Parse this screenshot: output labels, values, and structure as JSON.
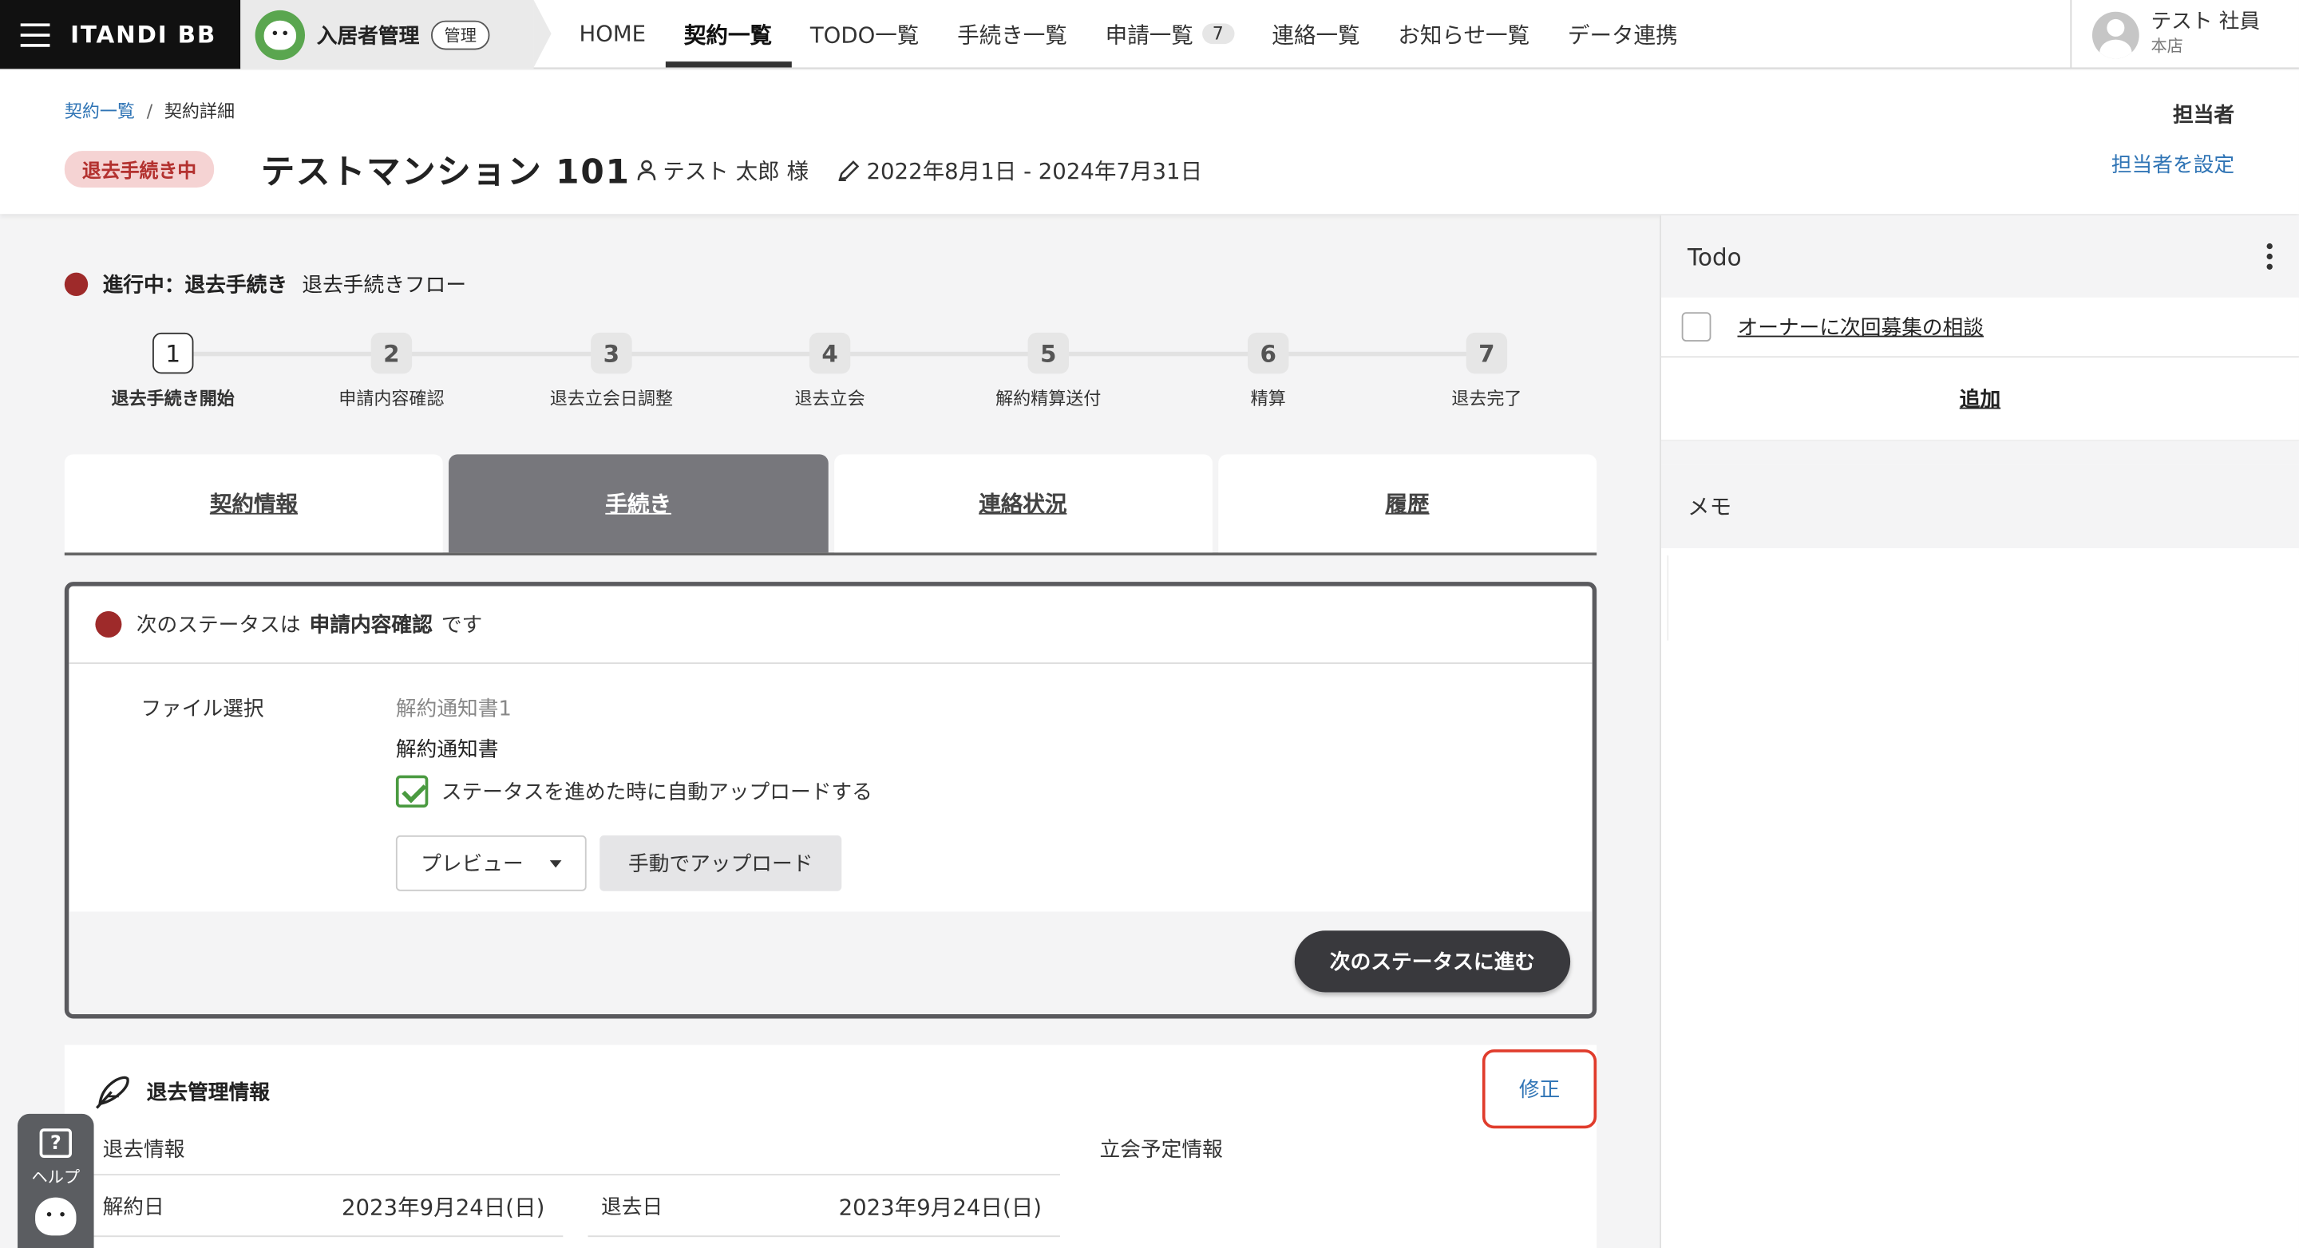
{
  "topbar": {
    "brand": "ITANDI BB",
    "product": "入居者管理",
    "admin_pill": "管理",
    "nav": [
      {
        "label": "HOME"
      },
      {
        "label": "契約一覧"
      },
      {
        "label": "TODO一覧"
      },
      {
        "label": "手続き一覧"
      },
      {
        "label": "申請一覧",
        "badge": "7"
      },
      {
        "label": "連絡一覧"
      },
      {
        "label": "お知らせ一覧"
      },
      {
        "label": "データ連携"
      }
    ],
    "active_nav": "契約一覧",
    "user": {
      "name": "テスト 社員",
      "branch": "本店"
    }
  },
  "header": {
    "breadcrumb": {
      "parent": "契約一覧",
      "current": "契約詳細"
    },
    "status_tag": "退去手続き中",
    "title": "テストマンション 101",
    "tenant": "テスト 太郎 様",
    "period": "2022年8月1日 - 2024年7月31日",
    "assignee_label": "担当者",
    "assignee_link": "担当者を設定"
  },
  "progress": {
    "prefix": "進行中：退去手続き",
    "flow": "退去手続きフロー",
    "steps": [
      {
        "num": "1",
        "label": "退去手続き開始"
      },
      {
        "num": "2",
        "label": "申請内容確認"
      },
      {
        "num": "3",
        "label": "退去立会日調整"
      },
      {
        "num": "4",
        "label": "退去立会"
      },
      {
        "num": "5",
        "label": "解約精算送付"
      },
      {
        "num": "6",
        "label": "精算"
      },
      {
        "num": "7",
        "label": "退去完了"
      }
    ],
    "current_step": 1
  },
  "tabs": [
    {
      "label": "契約情報"
    },
    {
      "label": "手続き"
    },
    {
      "label": "連絡状況"
    },
    {
      "label": "履歴"
    }
  ],
  "active_tab": "手続き",
  "status_card": {
    "next_prefix": "次のステータスは",
    "next_status": "申請内容確認",
    "next_suffix": "です",
    "file_label": "ファイル選択",
    "file_sub": "解約通知書1",
    "file_name": "解約通知書",
    "auto_upload": "ステータスを進めた時に自動アップロードする",
    "auto_upload_checked": true,
    "preview_button": "プレビュー",
    "manual_upload_button": "手動でアップロード",
    "next_button": "次のステータスに進む"
  },
  "exit_info": {
    "title": "退去管理情報",
    "edit_button": "修正",
    "exit_sub": "退去情報",
    "visit_sub": "立会予定情報",
    "cancel_date_label": "解約日",
    "cancel_date": "2023年9月24日(日)",
    "exit_date_label": "退去日",
    "exit_date": "2023年9月24日(日)"
  },
  "help": {
    "label": "ヘルプ"
  },
  "side": {
    "todo_title": "Todo",
    "todo_items": [
      {
        "text": "オーナーに次回募集の相談",
        "checked": false
      }
    ],
    "add_label": "追加",
    "memo_title": "メモ"
  },
  "colors": {
    "status_dot": "#9e2a2a",
    "status_tag_bg": "#f5d3d3",
    "status_tag_text": "#b3312f",
    "link": "#2f74b5",
    "edit_highlight": "#e03c2c",
    "check_green": "#4a9a40"
  }
}
